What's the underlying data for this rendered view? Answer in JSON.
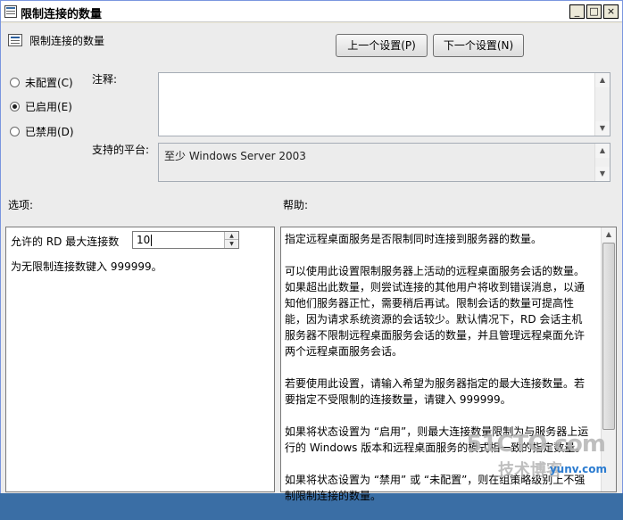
{
  "window": {
    "title": "限制连接的数量",
    "controls": [
      "_",
      "□",
      "×"
    ]
  },
  "header": {
    "policy_title": "限制连接的数量",
    "prev_button": "上一个设置(P)",
    "next_button": "下一个设置(N)"
  },
  "state": {
    "options": [
      {
        "label": "未配置(C)",
        "selected": false
      },
      {
        "label": "已启用(E)",
        "selected": true
      },
      {
        "label": "已禁用(D)",
        "selected": false
      }
    ]
  },
  "comment": {
    "label": "注释:",
    "value": ""
  },
  "platform": {
    "label": "支持的平台:",
    "value": "至少 Windows Server 2003"
  },
  "options_section": {
    "label": "选项:",
    "field_label": "允许的 RD 最大连接数",
    "field_value": "10",
    "hint": "为无限制连接数键入 999999。"
  },
  "help_section": {
    "label": "帮助:",
    "paragraphs": [
      "指定远程桌面服务是否限制同时连接到服务器的数量。",
      "可以使用此设置限制服务器上活动的远程桌面服务会话的数量。如果超出此数量，则尝试连接的其他用户将收到错误消息，以通知他们服务器正忙，需要稍后再试。限制会话的数量可提高性能，因为请求系统资源的会话较少。默认情况下，RD 会话主机服务器不限制远程桌面服务会话的数量，并且管理远程桌面允许两个远程桌面服务会话。",
      "若要使用此设置，请输入希望为服务器指定的最大连接数量。若要指定不受限制的连接数量，请键入 999999。",
      "如果将状态设置为 “启用”，则最大连接数量限制为与服务器上运行的 Windows 版本和远程桌面服务的模式相一致的指定数量。",
      "如果将状态设置为 “禁用” 或 “未配置”，则在组策略级别上不强制限制连接的数量。"
    ]
  },
  "watermark": {
    "line1": "51CTO.com",
    "line2": "技术博客",
    "line3": "yunv.com"
  }
}
